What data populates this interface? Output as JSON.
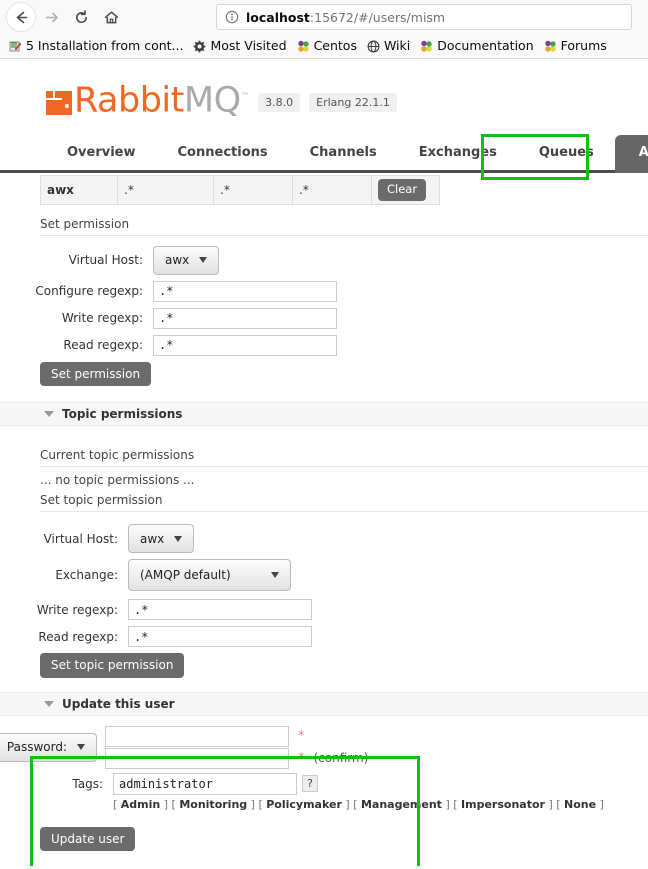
{
  "browser": {
    "toolbar": {
      "back_icon": "back-arrow-icon",
      "forward_icon": "forward-arrow-icon",
      "reload_icon": "reload-icon",
      "home_icon": "home-icon"
    },
    "urlbar": {
      "info_icon": "info-circle-icon",
      "host": "localhost",
      "rest": ":15672/#/users/mism"
    },
    "bookmarks": [
      {
        "label": "5 Installation from cont...",
        "icon": "notepad-icon"
      },
      {
        "label": "Most Visited",
        "icon": "gear-icon"
      },
      {
        "label": "Centos",
        "icon": "puzzle-icon"
      },
      {
        "label": "Wiki",
        "icon": "globe-icon"
      },
      {
        "label": "Documentation",
        "icon": "puzzle-icon"
      },
      {
        "label": "Forums",
        "icon": "puzzle-icon"
      }
    ]
  },
  "app": {
    "logo": {
      "rabbit": "Rabbit",
      "mq": "MQ",
      "tm": "™"
    },
    "version": "3.8.0",
    "erlang": "Erlang 22.1.1",
    "nav": [
      {
        "label": "Overview",
        "active": false
      },
      {
        "label": "Connections",
        "active": false
      },
      {
        "label": "Channels",
        "active": false
      },
      {
        "label": "Exchanges",
        "active": false
      },
      {
        "label": "Queues",
        "active": false
      },
      {
        "label": "Admin",
        "active": true
      }
    ]
  },
  "permissions": {
    "rows": [
      {
        "vhost": "awx",
        "configure": ".*",
        "write": ".*",
        "read": ".*",
        "action_label": "Clear"
      }
    ],
    "set_permission_title": "Set permission",
    "form": {
      "vhost_label": "Virtual Host:",
      "vhost_value": "awx",
      "configure_label": "Configure regexp:",
      "configure_value": ".*",
      "write_label": "Write regexp:",
      "write_value": ".*",
      "read_label": "Read regexp:",
      "read_value": ".*",
      "submit_label": "Set permission"
    }
  },
  "topic_permissions": {
    "section_title": "Topic permissions",
    "current_title": "Current topic permissions",
    "empty_text": "... no topic permissions ...",
    "set_title": "Set topic permission",
    "form": {
      "vhost_label": "Virtual Host:",
      "vhost_value": "awx",
      "exchange_label": "Exchange:",
      "exchange_value": "(AMQP default)",
      "write_label": "Write regexp:",
      "write_value": ".*",
      "read_label": "Read regexp:",
      "read_value": ".*",
      "submit_label": "Set topic permission"
    }
  },
  "update_user": {
    "section_title": "Update this user",
    "password_label": "Password:",
    "password_value": "",
    "password_confirm_value": "",
    "required_mark": "*",
    "confirm_text": "(confirm)",
    "tags_label": "Tags:",
    "tags_value": "administrator",
    "help_label": "?",
    "tag_links": [
      "Admin",
      "Monitoring",
      "Policymaker",
      "Management",
      "Impersonator",
      "None"
    ],
    "submit_label": "Update user"
  },
  "colors": {
    "brand_orange": "#f26722",
    "nav_active_bg": "#666666",
    "highlight_green": "#12c012",
    "button_gray": "#6b6b6b",
    "required_red": "#f08080"
  }
}
